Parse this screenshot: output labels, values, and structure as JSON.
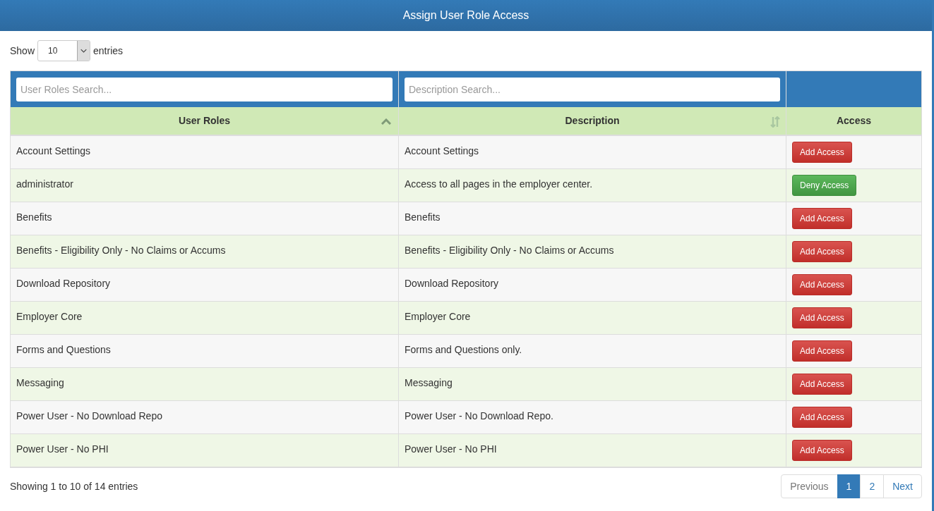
{
  "window": {
    "title": "Assign User Role Access"
  },
  "length_menu": {
    "label_before": "Show",
    "value": "10",
    "label_after": "entries"
  },
  "search_fields": [
    {
      "placeholder": "User Roles Search..."
    },
    {
      "placeholder": "Description Search..."
    }
  ],
  "columns": [
    {
      "label": "User Roles",
      "sortable": true,
      "sorted": true
    },
    {
      "label": "Description",
      "sortable": true,
      "sorted": false
    },
    {
      "label": "Access",
      "sortable": false
    }
  ],
  "rows": [
    {
      "role": "Account Settings",
      "description": "Account Settings",
      "action": {
        "kind": "add",
        "label": "Add Access"
      }
    },
    {
      "role": "administrator",
      "description": "Access to all pages in the employer center.",
      "action": {
        "kind": "deny",
        "label": "Deny Access"
      }
    },
    {
      "role": "Benefits",
      "description": "Benefits",
      "action": {
        "kind": "add",
        "label": "Add Access"
      }
    },
    {
      "role": "Benefits - Eligibility Only - No Claims or Accums",
      "description": "Benefits - Eligibility Only - No Claims or Accums",
      "action": {
        "kind": "add",
        "label": "Add Access"
      }
    },
    {
      "role": "Download Repository",
      "description": "Download Repository",
      "action": {
        "kind": "add",
        "label": "Add Access"
      }
    },
    {
      "role": "Employer Core",
      "description": "Employer Core",
      "action": {
        "kind": "add",
        "label": "Add Access"
      }
    },
    {
      "role": "Forms and Questions",
      "description": "Forms and Questions only.",
      "action": {
        "kind": "add",
        "label": "Add Access"
      }
    },
    {
      "role": "Messaging",
      "description": "Messaging",
      "action": {
        "kind": "add",
        "label": "Add Access"
      }
    },
    {
      "role": "Power User - No Download Repo",
      "description": "Power User - No Download Repo.",
      "action": {
        "kind": "add",
        "label": "Add Access"
      }
    },
    {
      "role": "Power User - No PHI",
      "description": "Power User - No PHI",
      "action": {
        "kind": "add",
        "label": "Add Access"
      }
    }
  ],
  "info": "Showing 1 to 10 of 14 entries",
  "pagination": [
    {
      "label": "Previous",
      "disabled": true,
      "selected": false
    },
    {
      "label": "1",
      "disabled": false,
      "selected": true
    },
    {
      "label": "2",
      "disabled": false,
      "selected": false
    },
    {
      "label": "Next",
      "disabled": false,
      "selected": false
    }
  ]
}
